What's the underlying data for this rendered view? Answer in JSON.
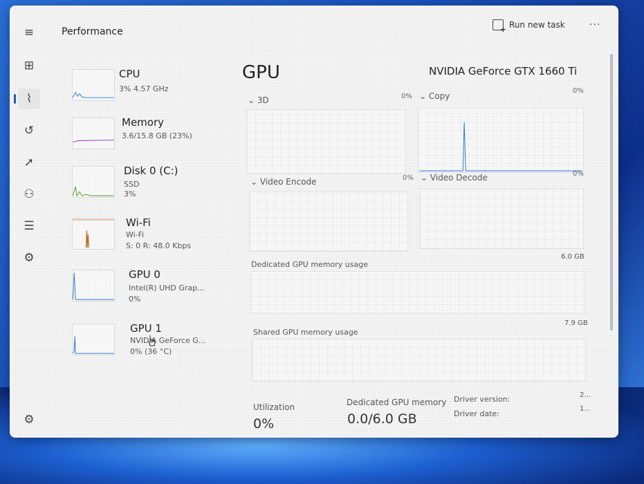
{
  "header": {
    "title": "Performance",
    "run_task_label": "Run new task",
    "more_label": "..."
  },
  "nav": [
    "processes-icon",
    "performance-icon",
    "app-history-icon",
    "startup-apps-icon",
    "users-icon",
    "details-icon",
    "services-icon",
    "settings-icon"
  ],
  "devices": [
    {
      "name": "CPU",
      "line1": "3% 4.57 GHz",
      "line2": "",
      "line3": "",
      "color": "#2b76d6"
    },
    {
      "name": "Memory",
      "line1": "3.6/15.8 GB (23%)",
      "line2": "",
      "line3": "",
      "color": "#8a3fb0"
    },
    {
      "name": "Disk 0 (C:)",
      "line1": "SSD",
      "line2": "3%",
      "line3": "",
      "color": "#4a9b25"
    },
    {
      "name": "Wi-Fi",
      "line1": "Wi-Fi",
      "line2": "S: 0 R: 48.0 Kbps",
      "line3": "",
      "color": "#c06a1d"
    },
    {
      "name": "GPU 0",
      "line1": "Intel(R) UHD Grap...",
      "line2": "0%",
      "line3": "",
      "color": "#2b76d6"
    },
    {
      "name": "GPU 1",
      "line1": "NVIDIA GeForce G...",
      "line2": "0% (36 °C)",
      "line3": "",
      "color": "#2b76d6"
    }
  ],
  "gpu": {
    "title": "GPU",
    "model": "NVIDIA GeForce GTX 1660 Ti",
    "engines": [
      {
        "label": "3D",
        "value": "0%"
      },
      {
        "label": "Copy",
        "value": "0%"
      },
      {
        "label": "Video Encode",
        "value": "0%"
      },
      {
        "label": "Video Decode",
        "value": "0%"
      }
    ],
    "dedicated_label": "Dedicated GPU memory usage",
    "dedicated_max": "6.0 GB",
    "shared_label": "Shared GPU memory usage",
    "shared_max": "7.9 GB"
  },
  "stats": {
    "utilization_label": "Utilization",
    "utilization_value": "0%",
    "dedicated_label": "Dedicated GPU memory",
    "dedicated_value": "0.0/6.0 GB",
    "driver_version_label": "Driver version:",
    "driver_version_value": "2...",
    "driver_date_label": "Driver date:",
    "driver_date_value": "1..."
  }
}
